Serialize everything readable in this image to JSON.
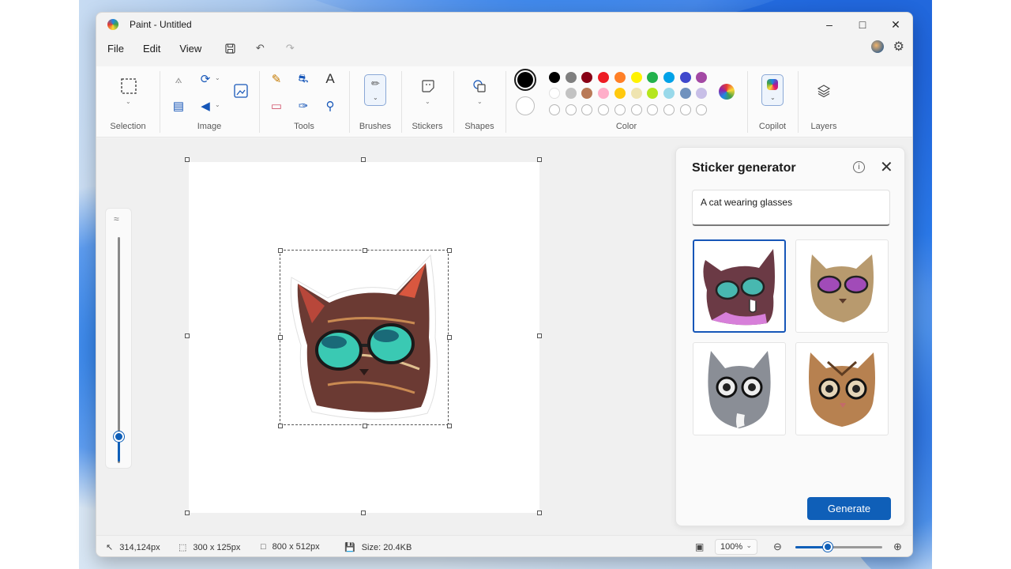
{
  "window": {
    "title": "Paint - Untitled"
  },
  "menu": {
    "file": "File",
    "edit": "Edit",
    "view": "View"
  },
  "ribbon": {
    "groups": {
      "selection": "Selection",
      "image": "Image",
      "tools": "Tools",
      "brushes": "Brushes",
      "stickers": "Stickers",
      "shapes": "Shapes",
      "color": "Color",
      "copilot": "Copilot",
      "layers": "Layers"
    },
    "colors": {
      "primary": "#000000",
      "secondary": "#ffffff",
      "row1": [
        "#000000",
        "#7f7f7f",
        "#880015",
        "#ed1c24",
        "#ff7f27",
        "#fff200",
        "#22b14c",
        "#00a2e8",
        "#3f48cc",
        "#a349a4"
      ],
      "row2": [
        "#ffffff",
        "#c3c3c3",
        "#b97a57",
        "#ffaec9",
        "#ffc90e",
        "#efe4b0",
        "#b5e61d",
        "#99d9ea",
        "#7092be",
        "#c8bfe7"
      ],
      "row3_count": 10
    }
  },
  "sticker_panel": {
    "title": "Sticker generator",
    "prompt": "A cat wearing glasses",
    "generate_label": "Generate",
    "selected_index": 0,
    "results": [
      "sticker-cat-sunglasses-1",
      "sticker-cat-sunglasses-2",
      "sticker-cat-glasses-gray",
      "sticker-cat-glasses-tabby"
    ]
  },
  "status": {
    "cursor": "314,124px",
    "selection_size": "300 x 125px",
    "canvas_size": "800 x 512px",
    "file_size": "Size: 20.4KB",
    "zoom": "100%"
  },
  "brush_size_level": 0.12
}
